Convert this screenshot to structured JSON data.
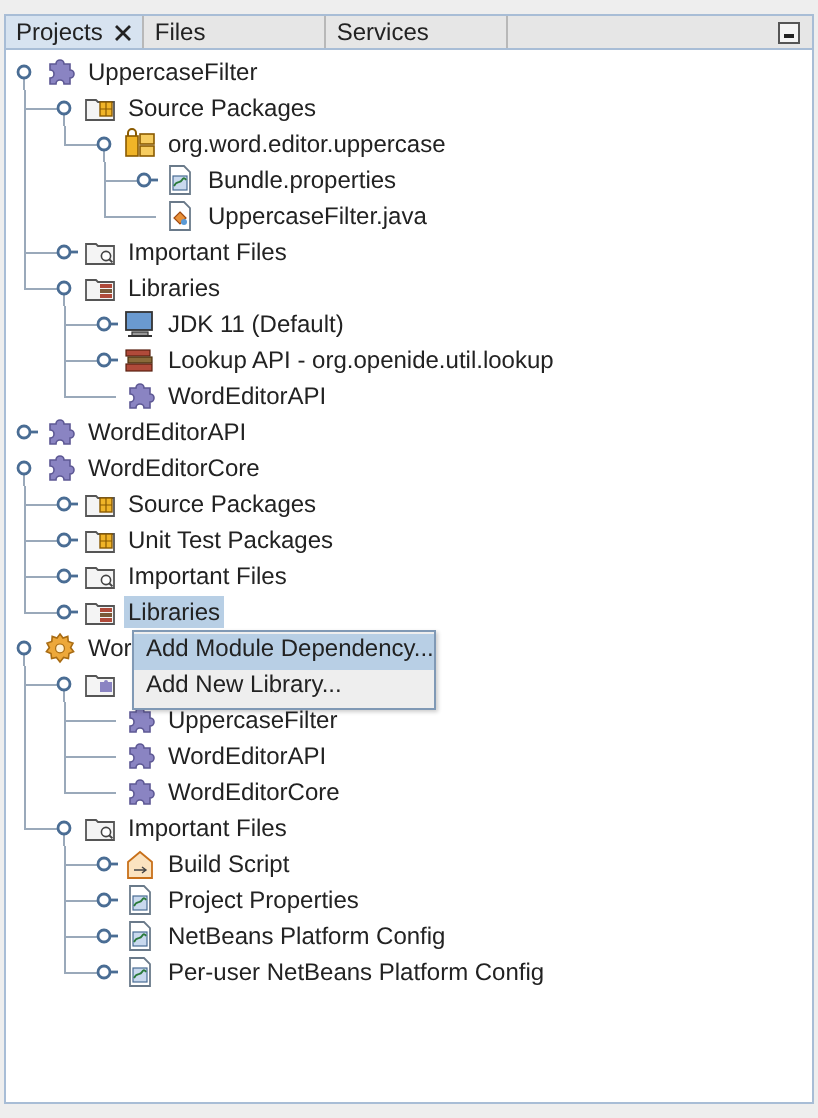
{
  "tabs": [
    {
      "label": "Projects",
      "selected": true
    },
    {
      "label": "Files",
      "selected": false
    },
    {
      "label": "Services",
      "selected": false
    }
  ],
  "tree": [
    {
      "label": "UppercaseFilter",
      "kind": "module",
      "expanded": true,
      "selected": false,
      "children": [
        {
          "label": "Source Packages",
          "kind": "source-folder",
          "expanded": true,
          "selected": false,
          "children": [
            {
              "label": "org.word.editor.uppercase",
              "kind": "package",
              "expanded": true,
              "selected": false,
              "children": [
                {
                  "label": "Bundle.properties",
                  "kind": "properties",
                  "expanded": false,
                  "selected": false
                },
                {
                  "label": "UppercaseFilter.java",
                  "kind": "java",
                  "selected": false
                }
              ]
            }
          ]
        },
        {
          "label": "Important Files",
          "kind": "files-folder",
          "expanded": false,
          "selected": false
        },
        {
          "label": "Libraries",
          "kind": "library-folder",
          "expanded": true,
          "selected": false,
          "children": [
            {
              "label": "JDK 11 (Default)",
              "kind": "jdk",
              "expanded": false,
              "selected": false
            },
            {
              "label": "Lookup API - org.openide.util.lookup",
              "kind": "jar",
              "expanded": false,
              "selected": false
            },
            {
              "label": "WordEditorAPI",
              "kind": "module",
              "selected": false
            }
          ]
        }
      ]
    },
    {
      "label": "WordEditorAPI",
      "kind": "module",
      "expanded": false,
      "selected": false
    },
    {
      "label": "WordEditorCore",
      "kind": "module",
      "expanded": true,
      "selected": false,
      "children": [
        {
          "label": "Source Packages",
          "kind": "source-folder",
          "expanded": false,
          "selected": false
        },
        {
          "label": "Unit Test Packages",
          "kind": "source-folder",
          "expanded": false,
          "selected": false
        },
        {
          "label": "Important Files",
          "kind": "files-folder",
          "expanded": false,
          "selected": false
        },
        {
          "label": "Libraries",
          "kind": "library-folder",
          "expanded": false,
          "selected": true
        }
      ]
    },
    {
      "label": "Wor",
      "kind": "suite",
      "expanded": true,
      "selected": false,
      "children": [
        {
          "kind": "modules-folder",
          "expanded": true,
          "selected": false,
          "children": [
            {
              "label": "UppercaseFilter",
              "kind": "module",
              "selected": false
            },
            {
              "label": "WordEditorAPI",
              "kind": "module",
              "selected": false
            },
            {
              "label": "WordEditorCore",
              "kind": "module",
              "selected": false
            }
          ]
        },
        {
          "label": "Important Files",
          "kind": "files-folder",
          "expanded": true,
          "selected": false,
          "children": [
            {
              "label": "Build Script",
              "kind": "build-script",
              "expanded": false,
              "selected": false
            },
            {
              "label": "Project Properties",
              "kind": "properties",
              "expanded": false,
              "selected": false
            },
            {
              "label": "NetBeans Platform Config",
              "kind": "properties",
              "expanded": false,
              "selected": false
            },
            {
              "label": "Per-user NetBeans Platform Config",
              "kind": "properties",
              "expanded": false,
              "selected": false
            }
          ]
        }
      ]
    }
  ],
  "context_menu": [
    {
      "label": "Add Module Dependency...",
      "selected": true
    },
    {
      "label": "Add New Library...",
      "selected": false
    }
  ]
}
